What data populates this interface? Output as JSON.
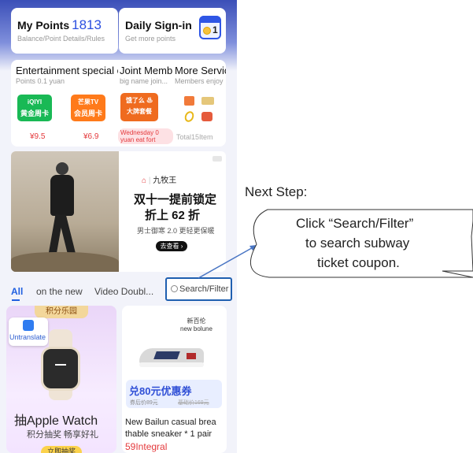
{
  "points": {
    "title": "My Points",
    "value": "1813",
    "subtitle": "Balance/Point Details/Rules"
  },
  "signin": {
    "title": "Daily Sign-in",
    "subtitle": "Get more points",
    "count": "1"
  },
  "services": {
    "entertainment": {
      "title": "Entertainment special c",
      "subtitle": "Points 0.1 yuan",
      "items": [
        {
          "line1": "iQIYI",
          "line2": "黄金周卡",
          "price": "¥9.5",
          "color": "#19b955"
        },
        {
          "line1": "芒果TV",
          "line2": "会员周卡",
          "price": "¥6.9",
          "color": "#ff7a1a"
        }
      ]
    },
    "joint": {
      "title": "Joint Memb",
      "subtitle": "big name join...",
      "tile_line1": "饿了么 ♨",
      "tile_line2": "大牌套餐",
      "badge_line1": "Wednesday 0",
      "badge_line2": "yuan eat fort"
    },
    "more": {
      "title": "More Servic",
      "subtitle": "Members enjoy",
      "total": "Total15Item"
    }
  },
  "banner": {
    "brand": "九牧王",
    "headline1": "双十一提前锁定",
    "headline2": "折上 62 折",
    "desc": "男士御寒 2.0 更轻更保暖",
    "cta": "去查看 ›"
  },
  "tabs": [
    "All",
    "on the new",
    "Video Doubl...",
    "Search/Filter"
  ],
  "products": {
    "left": {
      "ribbon": "积分乐园",
      "badge": "Untranslate",
      "title": "抽Apple Watch",
      "subtitle": "积分抽奖 畅享好礼",
      "button": "立即抽奖"
    },
    "right": {
      "brand1": "新百伦",
      "brand2": "new bolune",
      "coupon": "兑80元优惠券",
      "coupon_after": "券后价89元",
      "coupon_orig": "基础价169元",
      "name_line1": "New Bailun casual brea",
      "name_line2": "thable sneaker * 1 pair",
      "price": "59Integral"
    }
  },
  "annotation": {
    "next_step": "Next Step:",
    "line1": "Click “Search/Filter”",
    "line2": "to search subway",
    "line3": "ticket coupon."
  }
}
